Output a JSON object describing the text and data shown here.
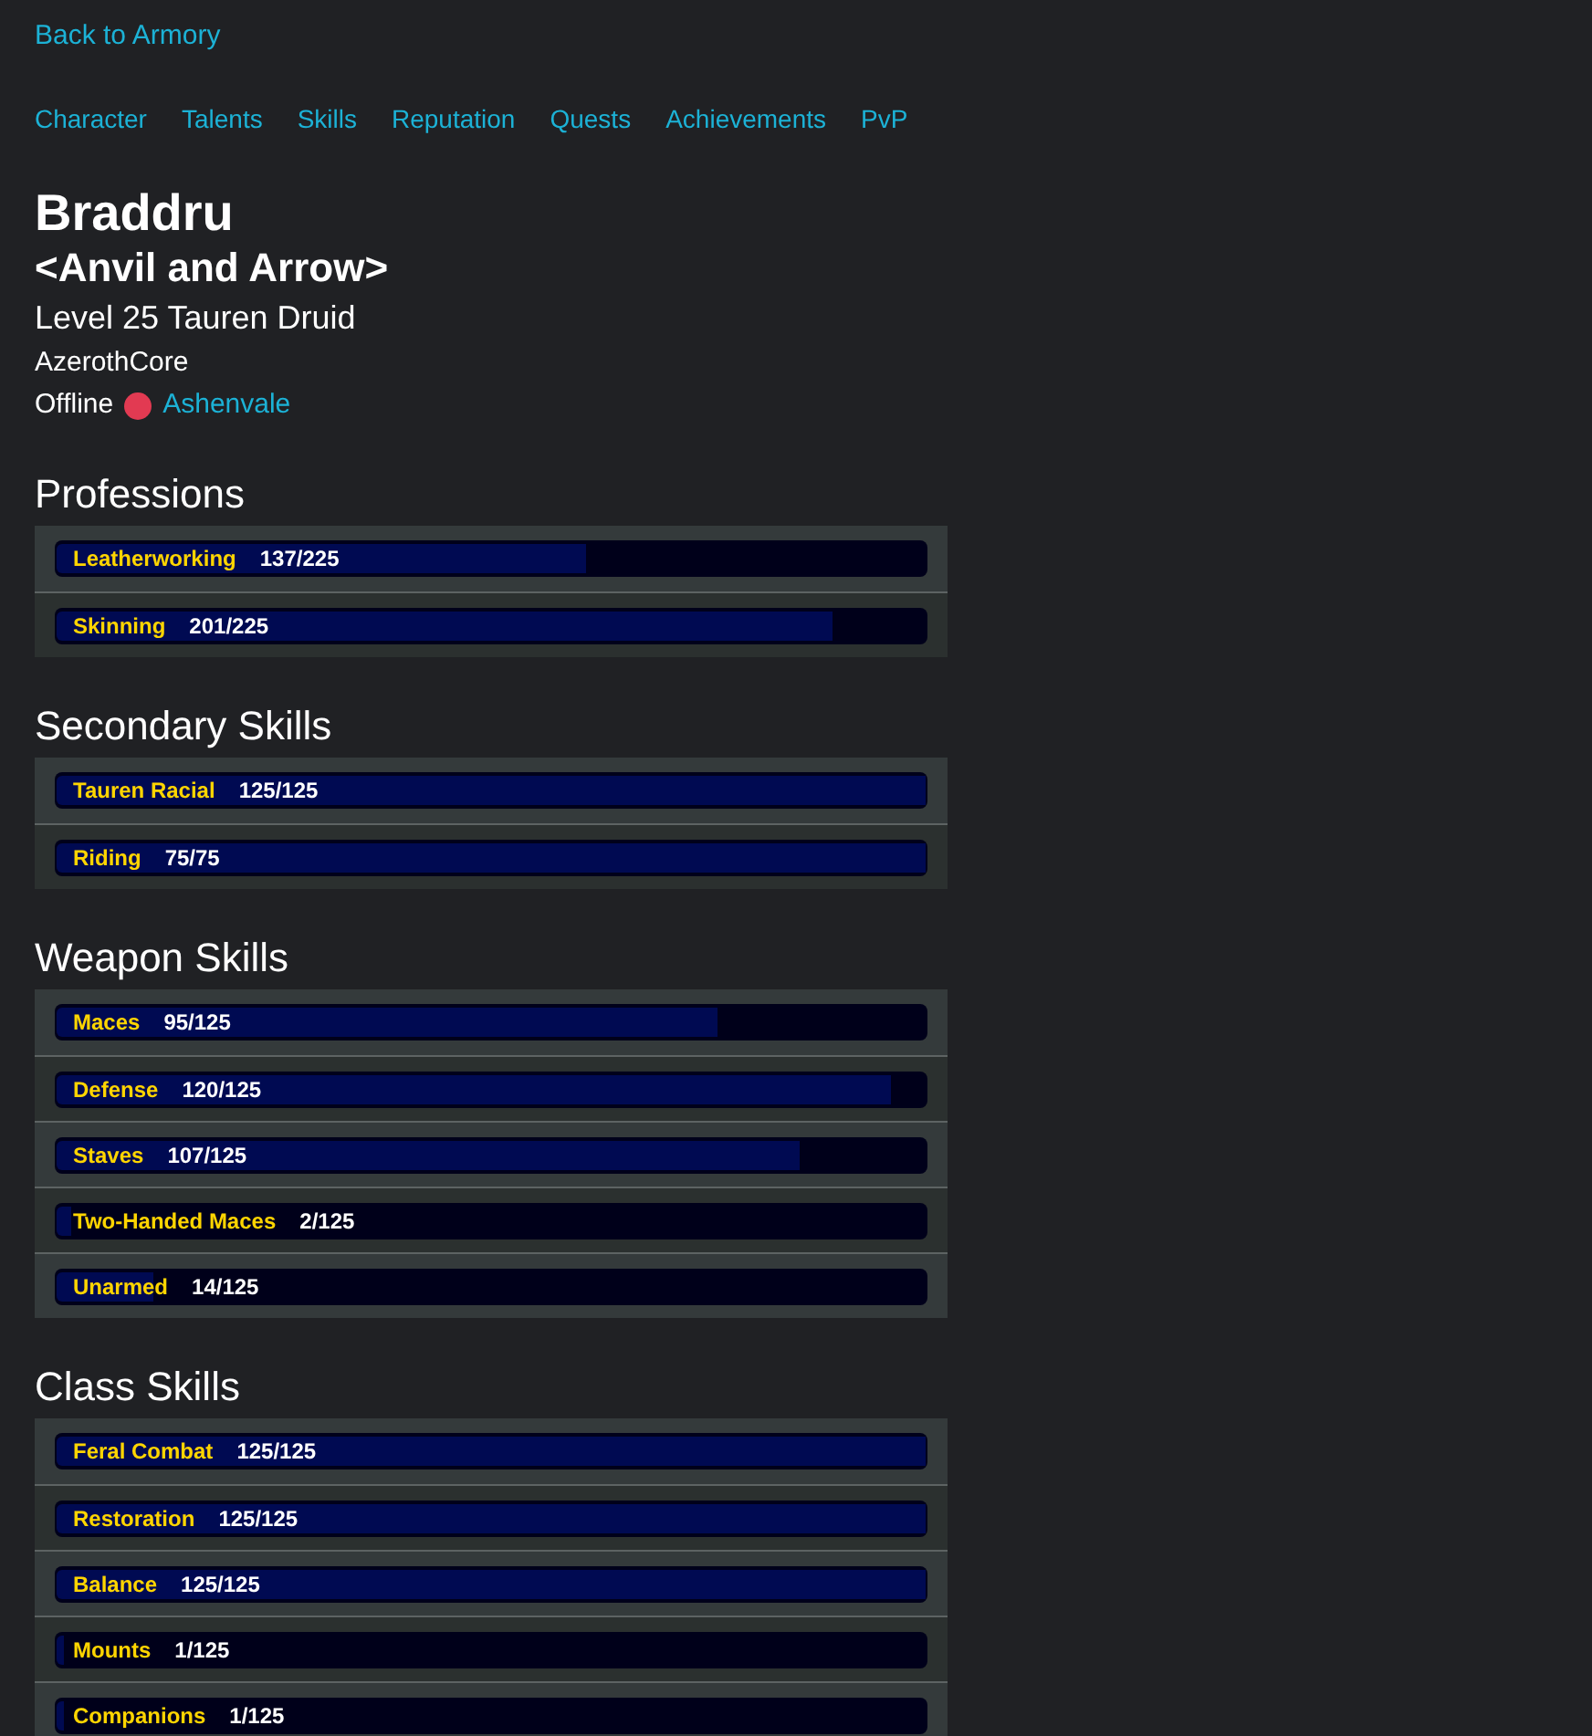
{
  "back_link": "Back to Armory",
  "nav": [
    "Character",
    "Talents",
    "Skills",
    "Reputation",
    "Quests",
    "Achievements",
    "PvP"
  ],
  "character": {
    "name": "Braddru",
    "guild": "<Anvil and Arrow>",
    "description": "Level 25 Tauren Druid",
    "realm": "AzerothCore",
    "status": {
      "label": "Offline",
      "color": "#e23a52"
    },
    "zone": "Ashenvale"
  },
  "sections": [
    {
      "title": "Professions",
      "skills": [
        {
          "name": "Leatherworking",
          "value": "137/225",
          "level": 0.609
        },
        {
          "name": "Skinning",
          "value": "201/225",
          "level": 0.893
        }
      ]
    },
    {
      "title": "Secondary Skills",
      "skills": [
        {
          "name": "Tauren Racial",
          "value": "125/125",
          "level": 1
        },
        {
          "name": "Riding",
          "value": "75/75",
          "level": 1
        }
      ]
    },
    {
      "title": "Weapon Skills",
      "skills": [
        {
          "name": "Maces",
          "value": "95/125",
          "level": 0.76
        },
        {
          "name": "Defense",
          "value": "120/125",
          "level": 0.96
        },
        {
          "name": "Staves",
          "value": "107/125",
          "level": 0.856
        },
        {
          "name": "Two-Handed Maces",
          "value": "2/125",
          "level": 0.016
        },
        {
          "name": "Unarmed",
          "value": "14/125",
          "level": 0.112
        }
      ]
    },
    {
      "title": "Class Skills",
      "skills": [
        {
          "name": "Feral Combat",
          "value": "125/125",
          "level": 1
        },
        {
          "name": "Restoration",
          "value": "125/125",
          "level": 1
        },
        {
          "name": "Balance",
          "value": "125/125",
          "level": 1
        },
        {
          "name": "Mounts",
          "value": "1/125",
          "level": 0.008
        },
        {
          "name": "Companions",
          "value": "1/125",
          "level": 0.008
        }
      ]
    }
  ]
}
